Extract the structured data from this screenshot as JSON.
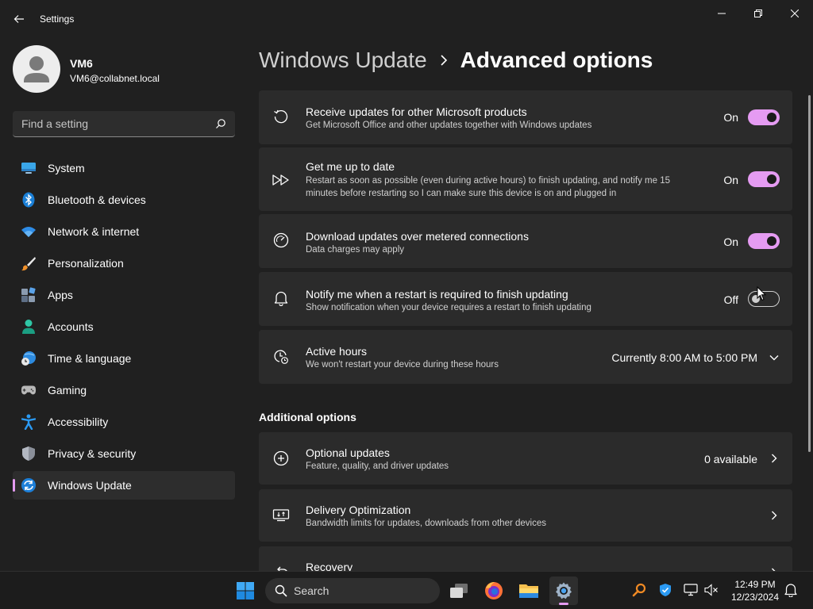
{
  "window": {
    "title": "Settings"
  },
  "profile": {
    "name": "VM6",
    "email": "VM6@collabnet.local"
  },
  "search": {
    "placeholder": "Find a setting"
  },
  "nav": {
    "items": [
      {
        "label": "System",
        "icon": "monitor-icon"
      },
      {
        "label": "Bluetooth & devices",
        "icon": "bluetooth-icon"
      },
      {
        "label": "Network & internet",
        "icon": "wifi-icon"
      },
      {
        "label": "Personalization",
        "icon": "brush-icon"
      },
      {
        "label": "Apps",
        "icon": "apps-icon"
      },
      {
        "label": "Accounts",
        "icon": "person-icon"
      },
      {
        "label": "Time & language",
        "icon": "globe-clock-icon"
      },
      {
        "label": "Gaming",
        "icon": "gamepad-icon"
      },
      {
        "label": "Accessibility",
        "icon": "accessibility-icon"
      },
      {
        "label": "Privacy & security",
        "icon": "shield-icon"
      },
      {
        "label": "Windows Update",
        "icon": "sync-icon",
        "active": true
      }
    ]
  },
  "breadcrumb": {
    "parent": "Windows Update",
    "current": "Advanced options"
  },
  "settings": [
    {
      "title": "Receive updates for other Microsoft products",
      "description": "Get Microsoft Office and other updates together with Windows updates",
      "state": "On",
      "enabled": true,
      "icon": "refresh-icon"
    },
    {
      "title": "Get me up to date",
      "description": "Restart as soon as possible (even during active hours) to finish updating, and notify me 15 minutes before restarting so I can make sure this device is on and plugged in",
      "state": "On",
      "enabled": true,
      "icon": "fast-forward-icon"
    },
    {
      "title": "Download updates over metered connections",
      "description": "Data charges may apply",
      "state": "On",
      "enabled": true,
      "icon": "gauge-icon"
    },
    {
      "title": "Notify me when a restart is required to finish updating",
      "description": "Show notification when your device requires a restart to finish updating",
      "state": "Off",
      "enabled": false,
      "icon": "bell-icon"
    }
  ],
  "active_hours": {
    "title": "Active hours",
    "description": "We won't restart your device during these hours",
    "value": "Currently 8:00 AM to 5:00 PM",
    "icon": "clock-icon"
  },
  "additional": {
    "heading": "Additional options",
    "items": [
      {
        "title": "Optional updates",
        "description": "Feature, quality, and driver updates",
        "value": "0 available",
        "icon": "plus-circle-icon"
      },
      {
        "title": "Delivery Optimization",
        "description": "Bandwidth limits for updates, downloads from other devices",
        "value": "",
        "icon": "delivery-icon"
      },
      {
        "title": "Recovery",
        "description": "",
        "value": "",
        "icon": "recovery-icon"
      }
    ]
  },
  "taskbar": {
    "search_label": "Search",
    "apps": [
      "windows-start-icon",
      "task-view-icon",
      "firefox-icon",
      "file-explorer-icon",
      "settings-gear-icon"
    ],
    "tray": [
      "magnifier-app-icon",
      "defender-icon",
      "network-icon",
      "volume-muted-icon"
    ],
    "time": "12:49 PM",
    "date": "12/23/2024"
  },
  "colors": {
    "accent": "#e59bf2",
    "background": "#202020",
    "card": "#2b2b2b"
  }
}
